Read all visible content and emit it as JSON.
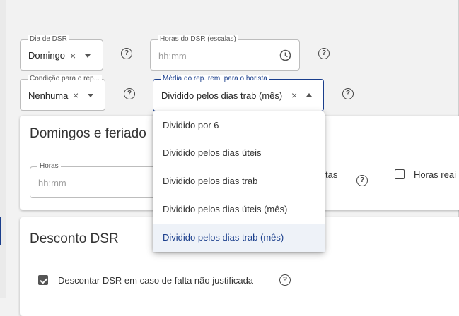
{
  "fields": {
    "dia_dsr": {
      "label": "Dia de DSR",
      "value": "Domingo"
    },
    "horas_dsr": {
      "label": "Horas do DSR (escalas)",
      "placeholder": "hh:mm"
    },
    "condicao": {
      "label": "Condição para o rep...",
      "value": "Nenhuma"
    },
    "media": {
      "label": "Média do rep. rem. para o horista",
      "value": "Dividido pelos dias trab (mês)"
    },
    "horas": {
      "label": "Horas",
      "placeholder": "hh:mm"
    }
  },
  "icons": {
    "clear": "×",
    "help": "?"
  },
  "cards": {
    "domingos": {
      "title": "Domingos e feriado",
      "partial_text": "tas",
      "horas_reais_label": "Horas reai"
    },
    "desconto": {
      "title": "Desconto DSR",
      "checkbox_label": "Descontar DSR em caso de falta não justificada",
      "checkbox_checked": true
    }
  },
  "dropdown": {
    "options": [
      "Dividido por 6",
      "Dividido pelos dias úteis",
      "Dividido pelos dias trab",
      "Dividido pelos dias úteis (mês)",
      "Dividido pelos dias trab (mês)"
    ],
    "selected_index": 4
  },
  "colors": {
    "accent": "#1a3e8c",
    "background": "#f2f2f2"
  }
}
